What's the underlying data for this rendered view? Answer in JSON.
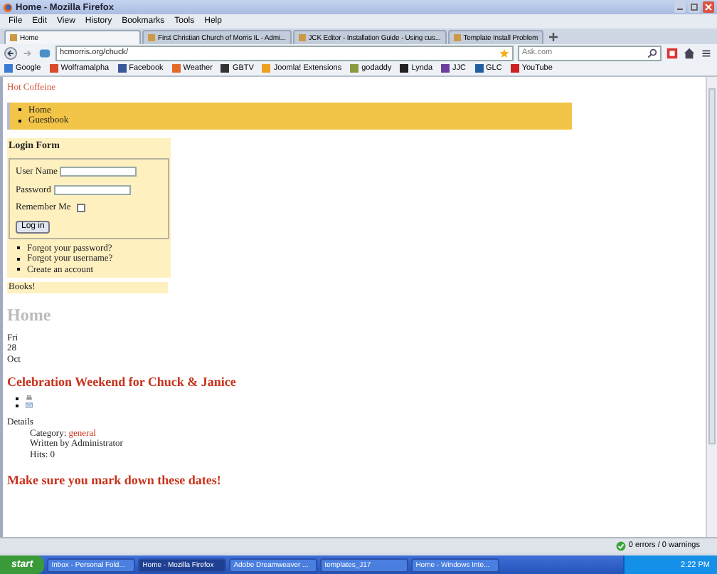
{
  "window": {
    "title": "Home - Mozilla Firefox"
  },
  "menu": [
    "File",
    "Edit",
    "View",
    "History",
    "Bookmarks",
    "Tools",
    "Help"
  ],
  "tabs": [
    {
      "label": "Home",
      "selected": true
    },
    {
      "label": "First Christian Church of Morris IL - Admi...",
      "selected": false
    },
    {
      "label": "JCK Editor - Installation Guide - Using cus...",
      "selected": false
    },
    {
      "label": "Template Install Problem",
      "selected": false
    }
  ],
  "address": {
    "value": "hcmorris.org/chuck/"
  },
  "search": {
    "placeholder": "Ask.com"
  },
  "bookmarks": [
    "Google",
    "Wolframalpha",
    "Facebook",
    "Weather",
    "GBTV",
    "Joomla! Extensions",
    "godaddy",
    "Lynda",
    "JJC",
    "GLC",
    "YouTube"
  ],
  "page": {
    "site_name": "Hot Coffeine",
    "nav": [
      "Home",
      "Guestbook"
    ],
    "login": {
      "title": "Login Form",
      "username_label": "User Name",
      "password_label": "Password",
      "remember_label": "Remember Me",
      "remember_checked": false,
      "button": "Log in",
      "links": [
        "Forgot your password?",
        "Forgot your username?",
        "Create an account"
      ]
    },
    "module_title": "Books!",
    "heading": "Home",
    "date": [
      "Fri",
      "28",
      "Oct"
    ],
    "article_title": "Celebration Weekend for Chuck & Janice",
    "details_label": "Details",
    "category_label": "Category:",
    "category": "general",
    "author": "Written by Administrator",
    "hits": "Hits: 0",
    "next_title": "Make sure you mark down these dates!"
  },
  "status_bar": {
    "text": "0 errors / 0 warnings"
  },
  "taskbar": {
    "start": "start",
    "tasks": [
      {
        "label": "Inbox - Personal Fold...",
        "selected": false
      },
      {
        "label": "Home - Mozilla Firefox",
        "selected": true
      },
      {
        "label": "Adobe Dreamweaver ...",
        "selected": false
      },
      {
        "label": "templates_J17",
        "selected": false
      },
      {
        "label": "Home - Windows Inte...",
        "selected": false
      }
    ],
    "clock": "2:22 PM"
  }
}
